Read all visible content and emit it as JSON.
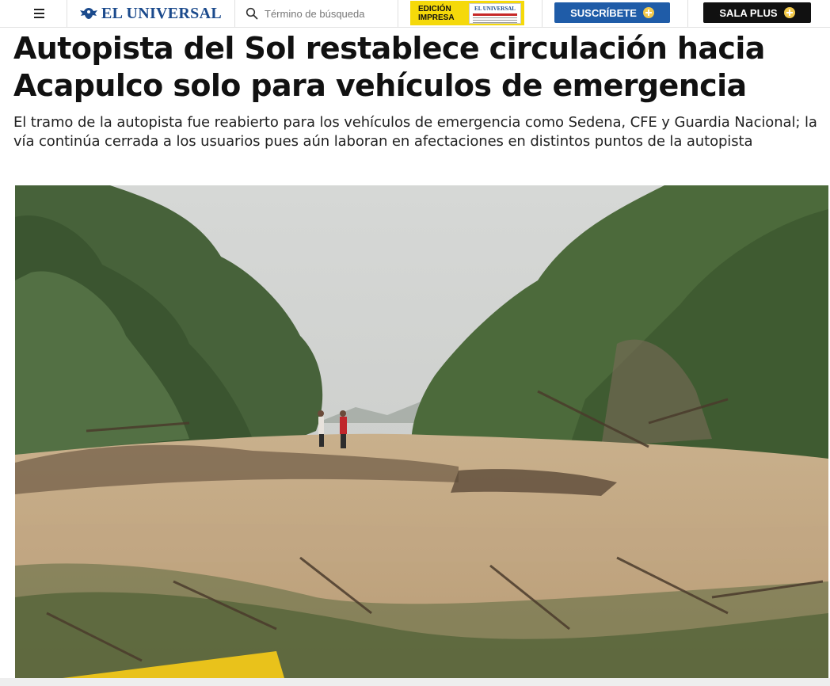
{
  "header": {
    "logo_text": "EL UNIVERSAL",
    "search_placeholder": "Término de búsqueda",
    "edicion_line1": "EDICIÓN",
    "edicion_line2": "IMPRESA",
    "edicion_masthead": "EL UNIVERSAL",
    "subscribe_label": "SUSCRÍBETE",
    "salaplus_label": "SALA PLUS"
  },
  "article": {
    "headline": "Autopista del Sol restablece circulación hacia Acapulco solo para vehículos de emergencia",
    "summary": "El tramo de la autopista fue reabierto para los vehículos de emergencia como Sedena, CFE y Guardia Nacional; la vía continúa cerrada a los usuarios pues aún laboran en afectaciones en distintos puntos de la autopista"
  },
  "icons": {
    "menu": "hamburger-menu-icon",
    "logo": "eagle-logo-icon",
    "search": "search-icon",
    "plus": "plus-circle-icon"
  },
  "colors": {
    "brand_blue": "#1b4a8c",
    "subscribe_bg": "#1f5ca8",
    "edicion_bg": "#f5d90a",
    "salaplus_bg": "#111111",
    "plus_accent": "#f2c94c"
  }
}
